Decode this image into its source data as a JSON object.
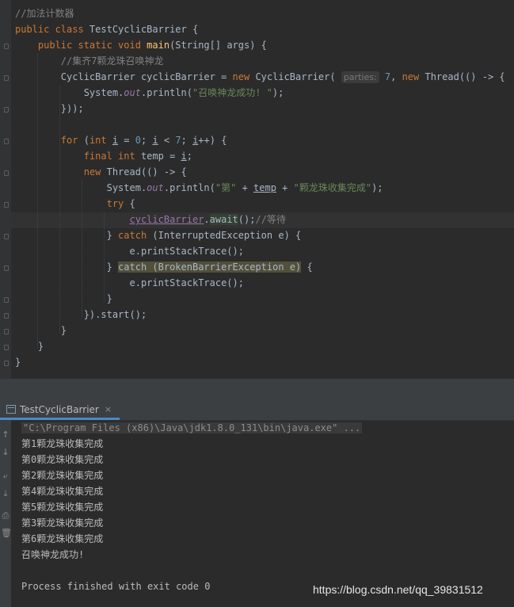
{
  "editor": {
    "lines": [
      {
        "segments": [
          {
            "t": "//加法计数器",
            "c": "cmt"
          }
        ]
      },
      {
        "segments": [
          {
            "t": "public class ",
            "c": "kw"
          },
          {
            "t": "TestCyclicBarrier {",
            "c": ""
          }
        ]
      },
      {
        "segments": [
          {
            "t": "    public static void ",
            "c": "kw"
          },
          {
            "t": "main",
            "c": "fn"
          },
          {
            "t": "(String[] args) {",
            "c": ""
          }
        ]
      },
      {
        "segments": [
          {
            "t": "        //集齐7颗龙珠召唤神龙",
            "c": "cmt"
          }
        ]
      },
      {
        "segments": [
          {
            "t": "        CyclicBarrier cyclicBarrier = ",
            "c": ""
          },
          {
            "t": "new ",
            "c": "kw"
          },
          {
            "t": "CyclicBarrier( ",
            "c": ""
          },
          {
            "t": "parties:",
            "c": "hint"
          },
          {
            "t": " 7",
            "c": "num"
          },
          {
            "t": ", ",
            "c": ""
          },
          {
            "t": "new ",
            "c": "kw"
          },
          {
            "t": "Thread(() -> {",
            "c": ""
          }
        ]
      },
      {
        "segments": [
          {
            "t": "            System.",
            "c": ""
          },
          {
            "t": "out",
            "c": "fld"
          },
          {
            "t": ".println(",
            "c": ""
          },
          {
            "t": "\"召唤神龙成功! \"",
            "c": "str"
          },
          {
            "t": ");",
            "c": ""
          }
        ]
      },
      {
        "segments": [
          {
            "t": "        }));",
            "c": ""
          }
        ]
      },
      {
        "segments": [
          {
            "t": "",
            "c": ""
          }
        ]
      },
      {
        "segments": [
          {
            "t": "        for ",
            "c": "kw"
          },
          {
            "t": "(",
            "c": ""
          },
          {
            "t": "int ",
            "c": "kw"
          },
          {
            "t": "i",
            "c": "ul"
          },
          {
            "t": " = ",
            "c": ""
          },
          {
            "t": "0",
            "c": "num"
          },
          {
            "t": "; ",
            "c": ""
          },
          {
            "t": "i",
            "c": "ul"
          },
          {
            "t": " < ",
            "c": ""
          },
          {
            "t": "7",
            "c": "num"
          },
          {
            "t": "; ",
            "c": ""
          },
          {
            "t": "i",
            "c": "ul"
          },
          {
            "t": "++) {",
            "c": ""
          }
        ]
      },
      {
        "segments": [
          {
            "t": "            final int ",
            "c": "kw"
          },
          {
            "t": "temp = ",
            "c": ""
          },
          {
            "t": "i",
            "c": "ul"
          },
          {
            "t": ";",
            "c": ""
          }
        ]
      },
      {
        "segments": [
          {
            "t": "            new ",
            "c": "kw"
          },
          {
            "t": "Thread(() -> {",
            "c": ""
          }
        ]
      },
      {
        "segments": [
          {
            "t": "                System.",
            "c": ""
          },
          {
            "t": "out",
            "c": "fld"
          },
          {
            "t": ".println(",
            "c": ""
          },
          {
            "t": "\"第\"",
            "c": "str"
          },
          {
            "t": " + ",
            "c": ""
          },
          {
            "t": "temp",
            "c": "ul"
          },
          {
            "t": " + ",
            "c": ""
          },
          {
            "t": "\"颗龙珠收集完成\"",
            "c": "str"
          },
          {
            "t": ");",
            "c": ""
          }
        ]
      },
      {
        "segments": [
          {
            "t": "                try ",
            "c": "kw"
          },
          {
            "t": "{",
            "c": ""
          }
        ]
      },
      {
        "segments": [
          {
            "t": "                    ",
            "c": ""
          },
          {
            "t": "cyclicBarrier",
            "c": "mfield"
          },
          {
            "t": ".",
            "c": ""
          },
          {
            "t": "await",
            "c": "await-bg"
          },
          {
            "t": "();",
            "c": ""
          },
          {
            "t": "//等待",
            "c": "cmt"
          }
        ]
      },
      {
        "segments": [
          {
            "t": "                } ",
            "c": ""
          },
          {
            "t": "catch ",
            "c": "kw"
          },
          {
            "t": "(InterruptedException e) {",
            "c": ""
          }
        ]
      },
      {
        "segments": [
          {
            "t": "                    e.printStackTrace();",
            "c": ""
          }
        ]
      },
      {
        "segments": [
          {
            "t": "                } ",
            "c": ""
          },
          {
            "t": "catch (BrokenBarrierException e)",
            "c": "warn-bg"
          },
          {
            "t": " {",
            "c": ""
          }
        ]
      },
      {
        "segments": [
          {
            "t": "                    e.printStackTrace();",
            "c": ""
          }
        ]
      },
      {
        "segments": [
          {
            "t": "                }",
            "c": ""
          }
        ]
      },
      {
        "segments": [
          {
            "t": "            }).start();",
            "c": ""
          }
        ]
      },
      {
        "segments": [
          {
            "t": "        }",
            "c": ""
          }
        ]
      },
      {
        "segments": [
          {
            "t": "    }",
            "c": ""
          }
        ]
      },
      {
        "segments": [
          {
            "t": "}",
            "c": ""
          }
        ]
      }
    ]
  },
  "run": {
    "tab_label": "TestCyclicBarrier",
    "tab_close": "×",
    "command": "\"C:\\Program Files (x86)\\Java\\jdk1.8.0_131\\bin\\java.exe\" ...",
    "output": [
      "第1颗龙珠收集完成",
      "第0颗龙珠收集完成",
      "第2颗龙珠收集完成",
      "第4颗龙珠收集完成",
      "第5颗龙珠收集完成",
      "第3颗龙珠收集完成",
      "第6颗龙珠收集完成",
      "召唤神龙成功!"
    ],
    "blank": "",
    "exit": "Process finished with exit code 0"
  },
  "watermark": "https://blog.csdn.net/qq_39831512"
}
